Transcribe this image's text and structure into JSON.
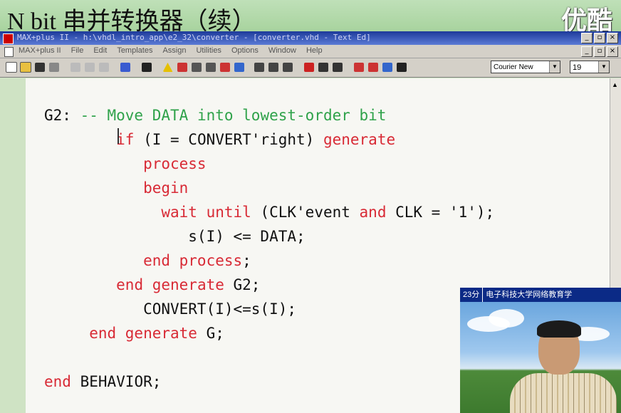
{
  "slide": {
    "title": "N bit 串并转换器（续）",
    "watermark": "优酷"
  },
  "window": {
    "title": "MAX+plus II - h:\\vhdl_intro_app\\e2_32\\converter - [converter.vhd - Text Ed]"
  },
  "menu": {
    "items": [
      "MAX+plus II",
      "File",
      "Edit",
      "Templates",
      "Assign",
      "Utilities",
      "Options",
      "Window",
      "Help"
    ]
  },
  "toolbar": {
    "font": "Courier New",
    "size": "19"
  },
  "editor": {
    "lines": [
      [
        {
          "t": "G2: ",
          "c": ""
        },
        {
          "t": "-- Move DATA into lowest-order bit",
          "c": "cm"
        }
      ],
      [
        {
          "t": "        ",
          "c": ""
        },
        {
          "t": "if",
          "c": "kw"
        },
        {
          "t": " (I = CONVERT'right) ",
          "c": ""
        },
        {
          "t": "generate",
          "c": "kw"
        }
      ],
      [
        {
          "t": "           ",
          "c": ""
        },
        {
          "t": "process",
          "c": "kw"
        }
      ],
      [
        {
          "t": "           ",
          "c": ""
        },
        {
          "t": "begin",
          "c": "kw"
        }
      ],
      [
        {
          "t": "             ",
          "c": ""
        },
        {
          "t": "wait until",
          "c": "kw"
        },
        {
          "t": " (CLK'event ",
          "c": ""
        },
        {
          "t": "and",
          "c": "kw"
        },
        {
          "t": " CLK = '1');",
          "c": ""
        }
      ],
      [
        {
          "t": "                s(I) <= DATA;",
          "c": ""
        }
      ],
      [
        {
          "t": "           ",
          "c": ""
        },
        {
          "t": "end process",
          "c": "kw"
        },
        {
          "t": ";",
          "c": ""
        }
      ],
      [
        {
          "t": "        ",
          "c": ""
        },
        {
          "t": "end generate",
          "c": "kw"
        },
        {
          "t": " G2;",
          "c": ""
        }
      ],
      [
        {
          "t": "           CONVERT(I)<=s(I);",
          "c": ""
        }
      ],
      [
        {
          "t": "     ",
          "c": ""
        },
        {
          "t": "end generate",
          "c": "kw"
        },
        {
          "t": " G;",
          "c": ""
        }
      ],
      [
        {
          "t": "",
          "c": ""
        }
      ],
      [
        {
          "t": "end",
          "c": "kw"
        },
        {
          "t": " BEHAVIOR;",
          "c": ""
        }
      ]
    ]
  },
  "video": {
    "time": "23分",
    "caption": "电子科技大学网络教育学"
  }
}
